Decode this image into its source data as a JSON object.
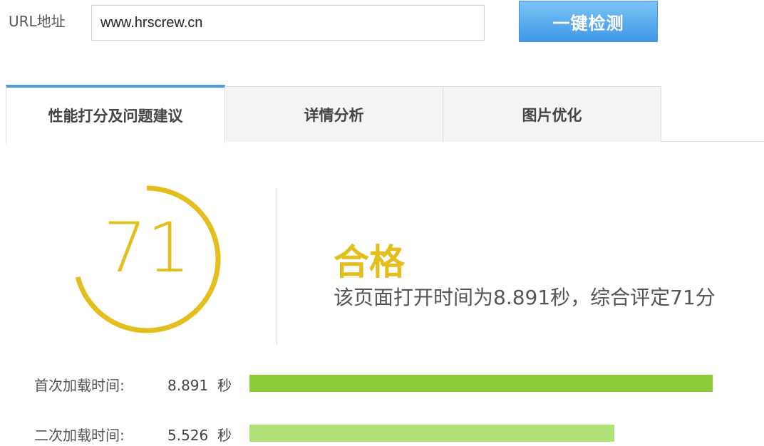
{
  "url_form": {
    "label": "URL地址",
    "value": "www.hrscrew.cn",
    "button_label": "一键检测"
  },
  "tabs": [
    {
      "label": "性能打分及问题建议",
      "active": true
    },
    {
      "label": "详情分析",
      "active": false
    },
    {
      "label": "图片优化",
      "active": false
    }
  ],
  "score": {
    "value": "71",
    "fraction": 0.71,
    "color": "#e3bf1e",
    "grade": "合格",
    "summary": "该页面打开时间为8.891秒，综合评定71分"
  },
  "metrics": [
    {
      "label": "首次加载时间:",
      "value": "8.891",
      "unit": "秒",
      "fraction": 1.0,
      "color": "#8dcc3a"
    },
    {
      "label": "二次加载时间:",
      "value": "5.526",
      "unit": "秒",
      "fraction": 0.787,
      "color": "#afe177"
    }
  ]
}
